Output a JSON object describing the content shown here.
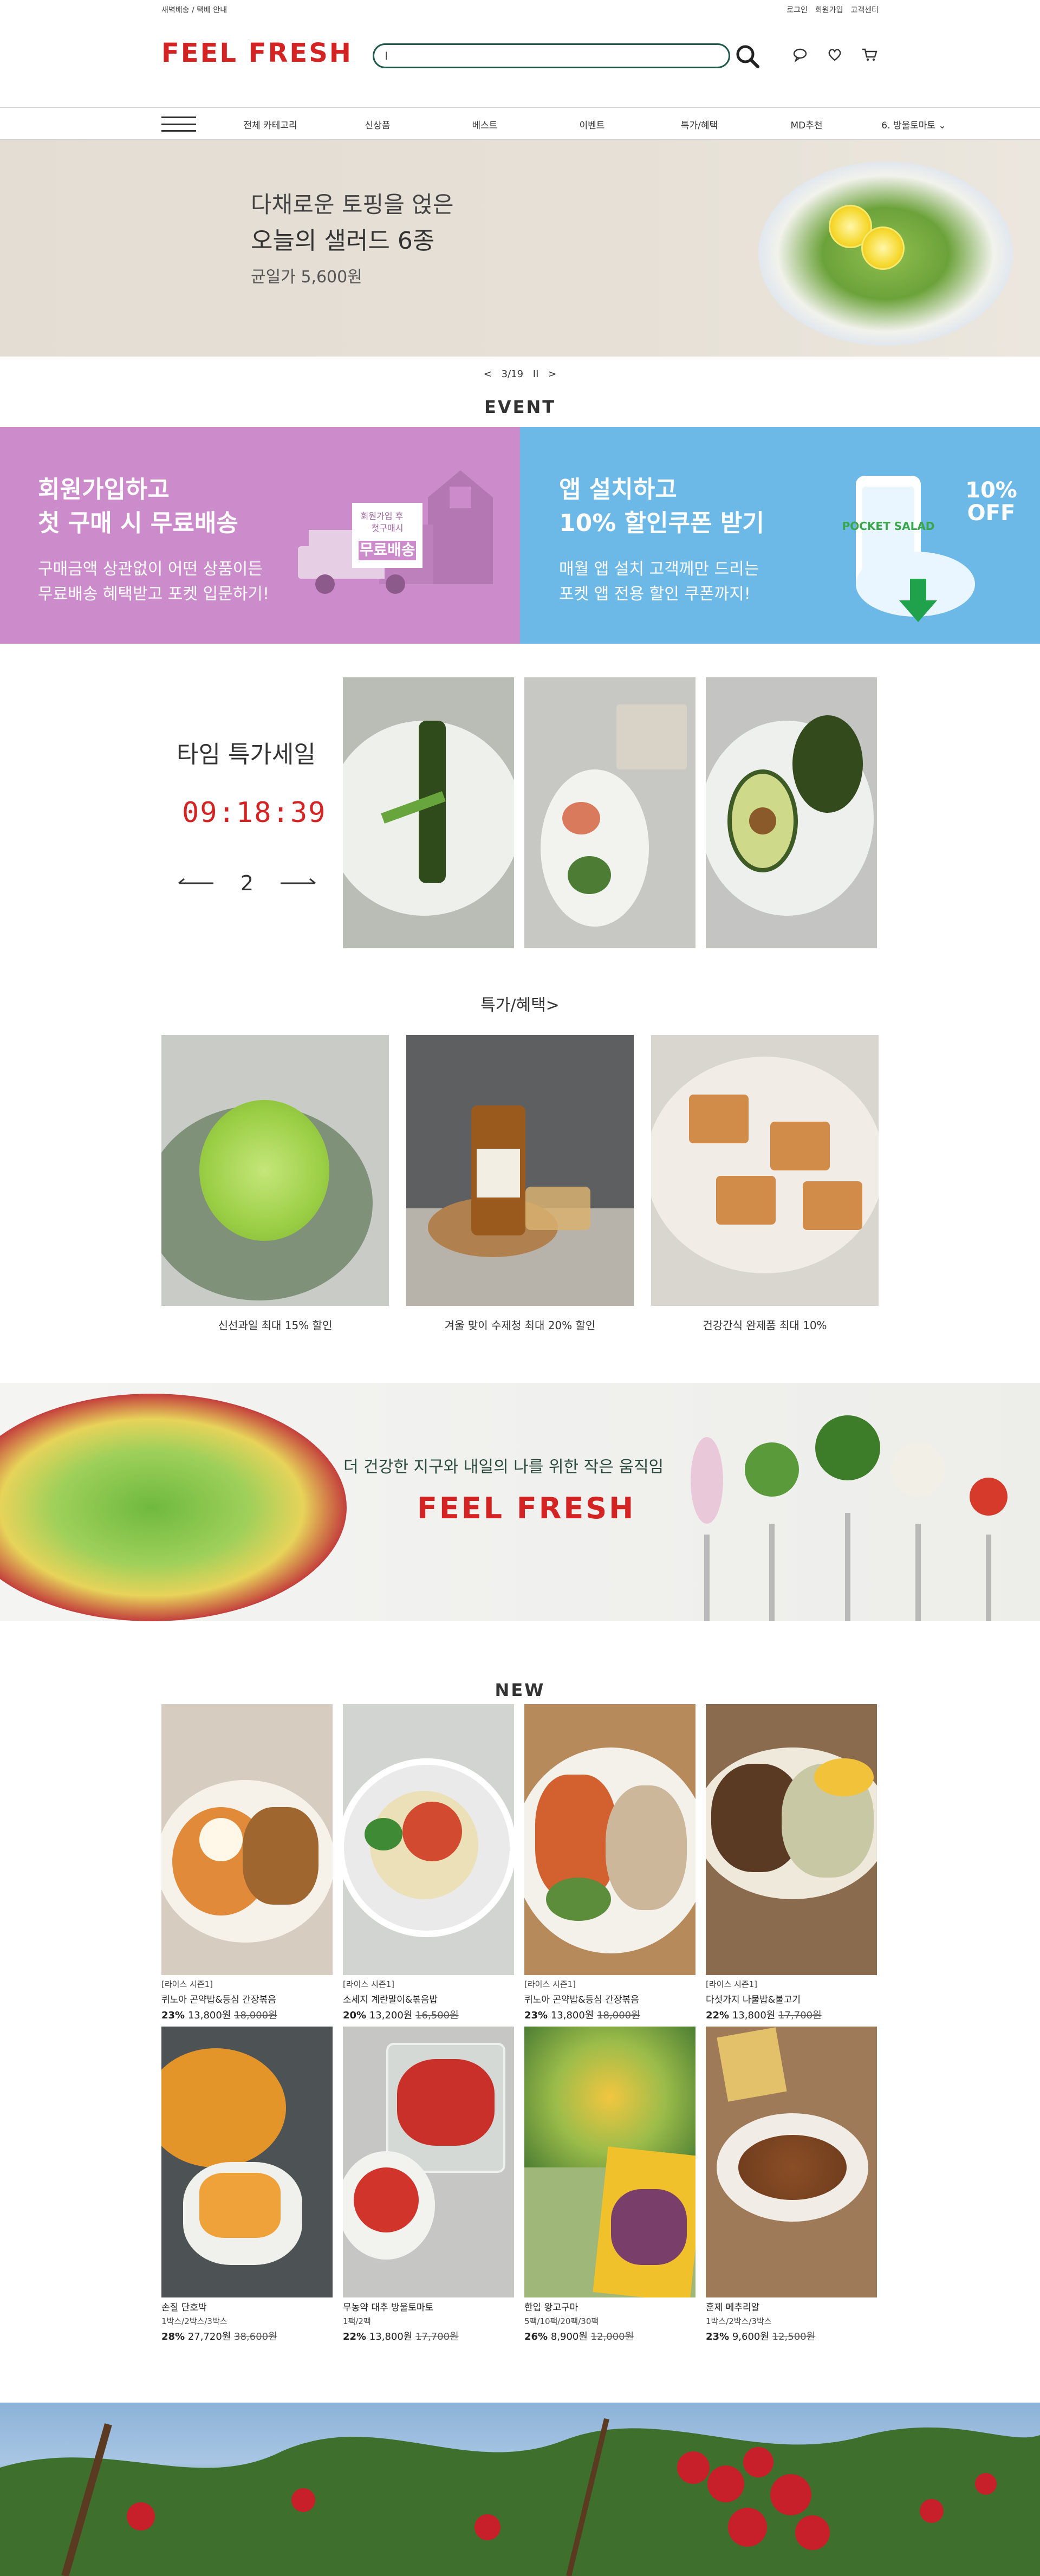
{
  "topbar": {
    "left": "새벽배송 / 택배 안내",
    "login": "로그인",
    "join": "회원가입",
    "cs": "고객센터"
  },
  "header": {
    "logo": "FEEL FRESH",
    "search_value": "|"
  },
  "nav": [
    "전체 카테고리",
    "신상품",
    "베스트",
    "이벤트",
    "특가/혜택",
    "MD추천",
    "6. 방울토마토  ⌄"
  ],
  "hero": {
    "line1": "다채로운 토핑을 얹은",
    "line2": "오늘의 샐러드 6종",
    "line3": "균일가 5,600원"
  },
  "pager": {
    "prev": "<",
    "current": "3/19",
    "pause": "II",
    "next": ">"
  },
  "event": {
    "title": "EVENT",
    "left": {
      "h1": "회원가입하고",
      "h2": "첫 구매 시 무료배송",
      "p1": "구매금액 상관없이 어떤 상품이든",
      "p2": "무료배송 혜택받고 포켓 입문하기!",
      "badge1": "회원가입 후",
      "badge2": "첫구매시",
      "badge3": "무료배송"
    },
    "right": {
      "h1": "앱 설치하고",
      "h2": "10% 할인쿠폰 받기",
      "p1": "매월 앱 설치 고객께만 드리는",
      "p2": "포켓 앱 전용 할인 쿠폰까지!",
      "offer1": "10%",
      "offer2": "OFF",
      "app": "POCKET SALAD"
    }
  },
  "timesale": {
    "title": "타임 특가세일",
    "timer": "09:18:39",
    "page": "2"
  },
  "benefits": {
    "title": "특가/혜택>",
    "items": [
      {
        "caption": "신선과일 최대 15% 할인"
      },
      {
        "caption": "겨울 맞이 수제청 최대 20% 할인"
      },
      {
        "caption": "건강간식 완제품 최대 10%"
      }
    ]
  },
  "brand": {
    "slogan": "더 건강한 지구와 내일의 나를 위한 작은 움직임",
    "logo": "FEEL FRESH"
  },
  "new": {
    "title": "NEW",
    "items": [
      {
        "cat": "[라이스 시즌1]",
        "name": "퀴노아 곤약밥&등심 간장볶음",
        "discount": "23%",
        "price": "13,800원",
        "orig": "18,000원"
      },
      {
        "cat": "[라이스 시즌1]",
        "name": "소세지 계란말이&볶음밥",
        "discount": "20%",
        "price": "13,200원",
        "orig": "16,500원"
      },
      {
        "cat": "[라이스 시즌1]",
        "name": "퀴노아 곤약밥&등심 간장볶음",
        "discount": "23%",
        "price": "13,800원",
        "orig": "18,000원"
      },
      {
        "cat": "[라이스 시즌1]",
        "name": "다섯가지 나물밥&불고기",
        "discount": "22%",
        "price": "13,800원",
        "orig": "17,700원"
      },
      {
        "name": "손질 단호박",
        "opt": "1박스/2박스/3박스",
        "discount": "28%",
        "price": "27,720원",
        "orig": "38,600원"
      },
      {
        "name": "무농약 대추 방울토마토",
        "opt": "1팩/2팩",
        "discount": "22%",
        "price": "13,800원",
        "orig": "17,700원"
      },
      {
        "name": "한입 왕고구마",
        "opt": "5팩/10팩/20팩/30팩",
        "discount": "26%",
        "price": "8,900원",
        "orig": "12,000원"
      },
      {
        "name": "훈제 메추리알",
        "opt": "1박스/2박스/3박스",
        "discount": "23%",
        "price": "9,600원",
        "orig": "12,500원"
      }
    ]
  },
  "colors": {
    "brand": "#d42323",
    "search_border": "#1f5a4a",
    "event_pink": "#cc8ccb",
    "event_blue": "#6cb8e6"
  }
}
